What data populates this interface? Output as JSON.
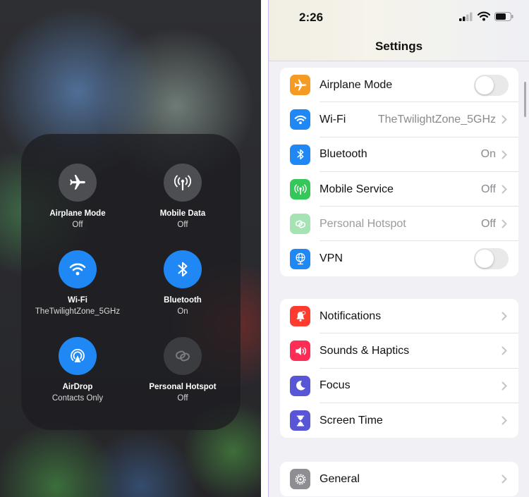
{
  "control_center": {
    "tiles": [
      {
        "id": "airplane",
        "title": "Airplane Mode",
        "subtitle": "Off",
        "icon": "airplane-icon",
        "state": "off"
      },
      {
        "id": "mobile-data",
        "title": "Mobile Data",
        "subtitle": "Off",
        "icon": "antenna-icon",
        "state": "off"
      },
      {
        "id": "wifi",
        "title": "Wi-Fi",
        "subtitle": "TheTwilightZone_5GHz",
        "icon": "wifi-icon",
        "state": "on"
      },
      {
        "id": "bluetooth",
        "title": "Bluetooth",
        "subtitle": "On",
        "icon": "bluetooth-icon",
        "state": "on"
      },
      {
        "id": "airdrop",
        "title": "AirDrop",
        "subtitle": "Contacts Only",
        "icon": "airdrop-icon",
        "state": "on"
      },
      {
        "id": "hotspot",
        "title": "Personal Hotspot",
        "subtitle": "Off",
        "icon": "hotspot-icon",
        "state": "disabled"
      }
    ],
    "colors": {
      "active": "#1f88f5",
      "inactive": "#4d4e51"
    }
  },
  "settings": {
    "status_bar": {
      "time": "2:26"
    },
    "title": "Settings",
    "groups": [
      {
        "rows": [
          {
            "label": "Airplane Mode",
            "icon": "airplane-icon",
            "icon_color": "#f59a23",
            "accessory": "toggle",
            "toggle_on": false
          },
          {
            "label": "Wi-Fi",
            "icon": "wifi-icon",
            "icon_color": "#1f88f5",
            "value": "TheTwilightZone_5GHz",
            "accessory": "chevron"
          },
          {
            "label": "Bluetooth",
            "icon": "bluetooth-icon",
            "icon_color": "#1f88f5",
            "value": "On",
            "accessory": "chevron"
          },
          {
            "label": "Mobile Service",
            "icon": "antenna-icon",
            "icon_color": "#34c759",
            "value": "Off",
            "accessory": "chevron"
          },
          {
            "label": "Personal Hotspot",
            "icon": "hotspot-icon",
            "icon_color": "#a6e3b4",
            "value": "Off",
            "accessory": "chevron",
            "disabled": true
          },
          {
            "label": "VPN",
            "icon": "globe-icon",
            "icon_color": "#1f88f5",
            "accessory": "toggle",
            "toggle_on": false
          }
        ]
      },
      {
        "rows": [
          {
            "label": "Notifications",
            "icon": "bell-icon",
            "icon_color": "#ff3b30",
            "accessory": "chevron"
          },
          {
            "label": "Sounds & Haptics",
            "icon": "speaker-icon",
            "icon_color": "#ff2d55",
            "accessory": "chevron"
          },
          {
            "label": "Focus",
            "icon": "moon-icon",
            "icon_color": "#5856d6",
            "accessory": "chevron"
          },
          {
            "label": "Screen Time",
            "icon": "hourglass-icon",
            "icon_color": "#5856d6",
            "accessory": "chevron"
          }
        ]
      },
      {
        "rows": [
          {
            "label": "General",
            "icon": "gear-icon",
            "icon_color": "#8e8e93",
            "accessory": "chevron"
          }
        ]
      }
    ]
  }
}
